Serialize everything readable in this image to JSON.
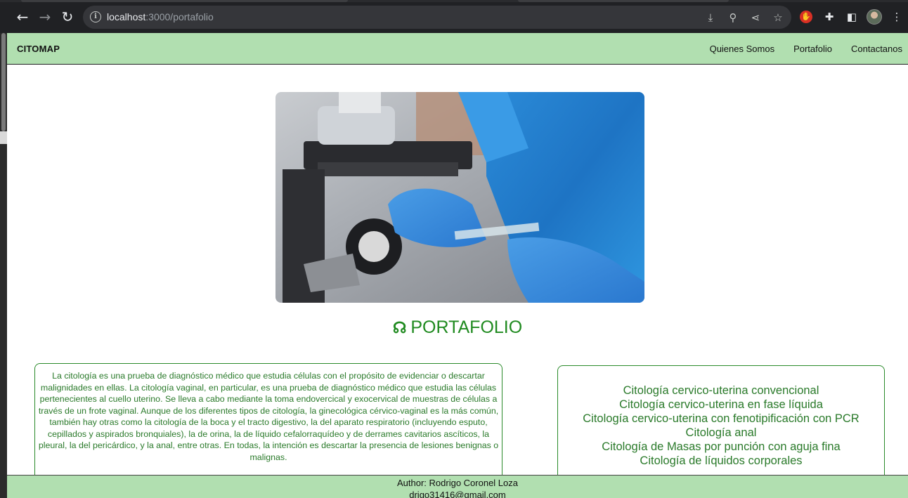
{
  "browser": {
    "url_host": "localhost",
    "url_path": ":3000/portafolio"
  },
  "navbar": {
    "brand": "CITOMAP",
    "links": [
      "Quienes Somos",
      "Portafolio",
      "Contactanos"
    ]
  },
  "hero_image": {
    "subject": "microscope-slide-photo"
  },
  "section": {
    "title": "PORTAFOLIO",
    "icon": "headphones-icon"
  },
  "description": "La citología es una prueba de diagnóstico médico que estudia células con el propósito de evidenciar o descartar malignidades en ellas. La citología vaginal, en particular, es una prueba de diagnóstico médico que estudia las células pertenecientes al cuello uterino. Se lleva a cabo mediante la toma endovercical y exocervical de muestras de células a través de un frote vaginal. Aunque de los diferentes tipos de citología, la ginecológica cérvico-vaginal es la más común, también hay otras como la citología de la boca y el tracto digestivo, la del aparato respiratorio (incluyendo esputo, cepillados y aspirados bronquiales), la de orina, la de líquido cefalorraquídeo y de derrames cavitarios ascíticos, la pleural, la del pericárdico, y la anal, entre otras. En todas, la intención es descartar la presencia de lesiones benignas o malignas.",
  "services": [
    "Citología cervico-uterina convencional",
    "Citología cervico-uterina en fase líquida",
    "Citología cervico-uterina con fenotipificación con PCR",
    "Citología anal",
    "Citología de Masas por punción con aguja fina",
    "Citología de líquidos corporales"
  ],
  "footer": {
    "author": "Author: Rodrigo Coronel Loza",
    "email": "drigo31416@gmail.com"
  },
  "colors": {
    "navbar_bg": "#b1dfb0",
    "accent_green": "#1f8a1f"
  }
}
